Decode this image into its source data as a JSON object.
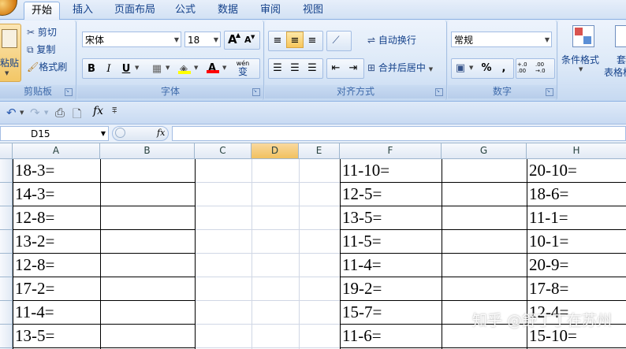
{
  "tabs": [
    "开始",
    "插入",
    "页面布局",
    "公式",
    "数据",
    "审阅",
    "视图"
  ],
  "clipboard": {
    "paste": "粘贴",
    "cut": "剪切",
    "copy": "复制",
    "format_painter": "格式刷",
    "label": "剪贴板"
  },
  "font": {
    "name": "宋体",
    "size": "18",
    "bold": "B",
    "italic": "I",
    "underline": "U",
    "grow": "A",
    "shrink": "A",
    "wen": "wén",
    "wen_sub": "变",
    "label": "字体"
  },
  "alignment": {
    "wrap": "自动换行",
    "merge": "合并后居中",
    "label": "对齐方式"
  },
  "number": {
    "format": "常规",
    "percent": "%",
    "comma": ",",
    "inc_decimal": "+.0 .00",
    "dec_decimal": ".00 →.0",
    "label": "数字"
  },
  "styles": {
    "conditional": "条件格式",
    "table_format_1": "套",
    "table_format_2": "表格格"
  },
  "formula_bar": {
    "cell_ref": "D15",
    "fx": "fx"
  },
  "columns": [
    "A",
    "B",
    "C",
    "D",
    "E",
    "F",
    "G",
    "H"
  ],
  "active_column": "D",
  "sheet": {
    "col_a": [
      "18-3=",
      "14-3=",
      "12-8=",
      "13-2=",
      "12-8=",
      "17-2=",
      "11-4=",
      "13-5="
    ],
    "col_f": [
      "11-10=",
      "12-5=",
      "13-5=",
      "11-5=",
      "11-4=",
      "19-2=",
      "15-7=",
      "11-6="
    ],
    "col_h": [
      "20-10=",
      "18-6=",
      "11-1=",
      "10-1=",
      "20-9=",
      "17-8=",
      "12-4=",
      "15-10="
    ]
  },
  "watermark": "知乎 @舒丁丁在苏州",
  "colors": {
    "accent": "#15428b",
    "active_col": "#f1c15f",
    "ribbon": "#d5e4f6"
  }
}
